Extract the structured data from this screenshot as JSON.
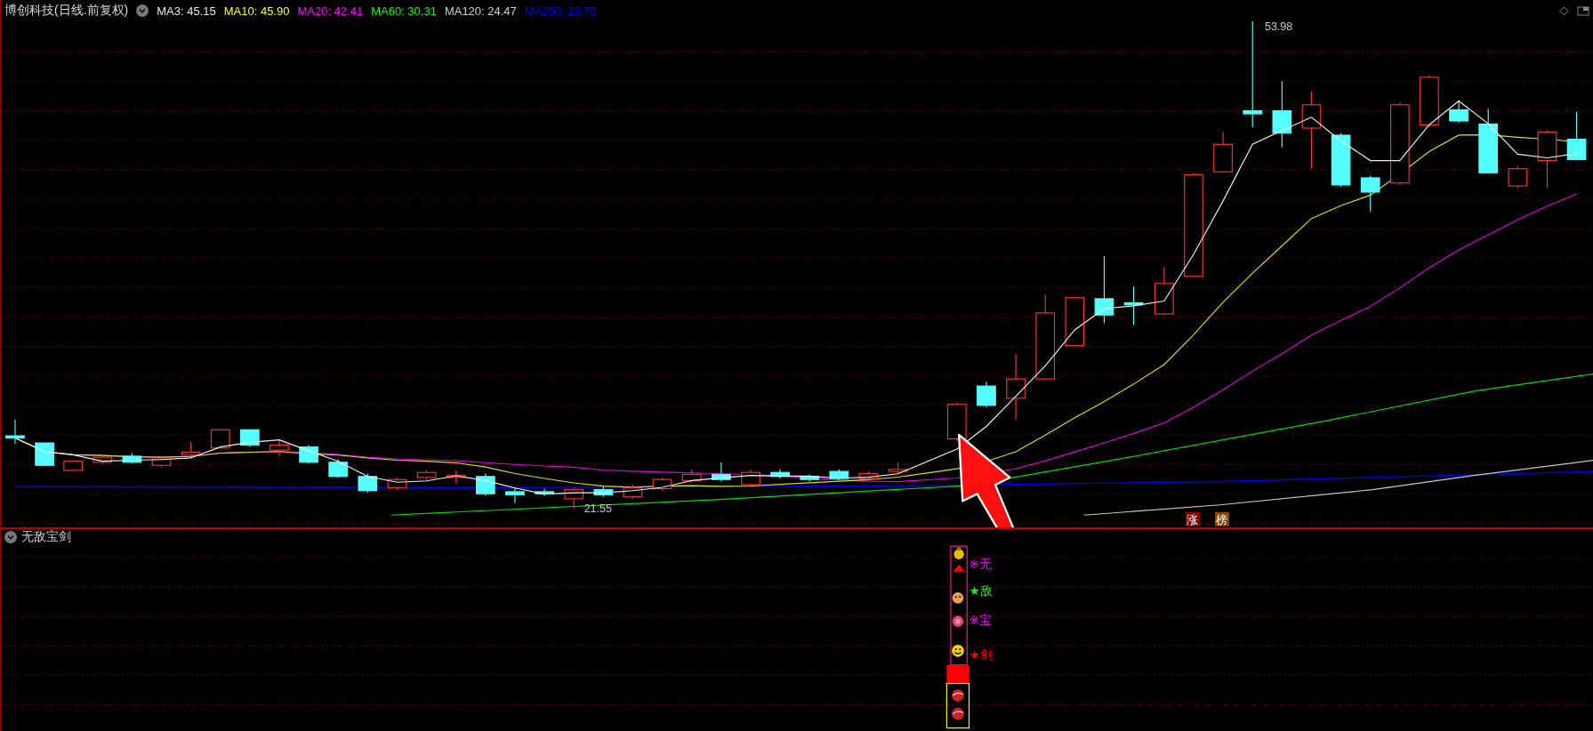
{
  "main_chart": {
    "title": "博创科技(日线.前复权)",
    "ma_legend": [
      {
        "text": "MA3: 45.15",
        "color": "#e6e6e6"
      },
      {
        "text": "MA10: 45.90",
        "color": "#ffff00"
      },
      {
        "text": "MA20: 42.41",
        "color": "#ff00ff"
      },
      {
        "text": "MA60: 30.31",
        "color": "#00ff00"
      },
      {
        "text": "MA120: 24.47",
        "color": "#d0d0d0"
      },
      {
        "text": "MA250: 23.75",
        "color": "#0000ff"
      }
    ],
    "high_label": "53.98",
    "low_label": "21.55",
    "badges": [
      {
        "text": "涨",
        "color": "#8b0000"
      },
      {
        "text": "榜",
        "color": "#8b4500"
      }
    ]
  },
  "indicator": {
    "title": "无敌宝剑",
    "signals": [
      {
        "text": "※无",
        "color": "#ff00ff"
      },
      {
        "text": "★敌",
        "color": "#00ff00"
      },
      {
        "text": "※宝",
        "color": "#ff00ff"
      },
      {
        "text": "★剑",
        "color": "#ff0000"
      }
    ]
  }
}
